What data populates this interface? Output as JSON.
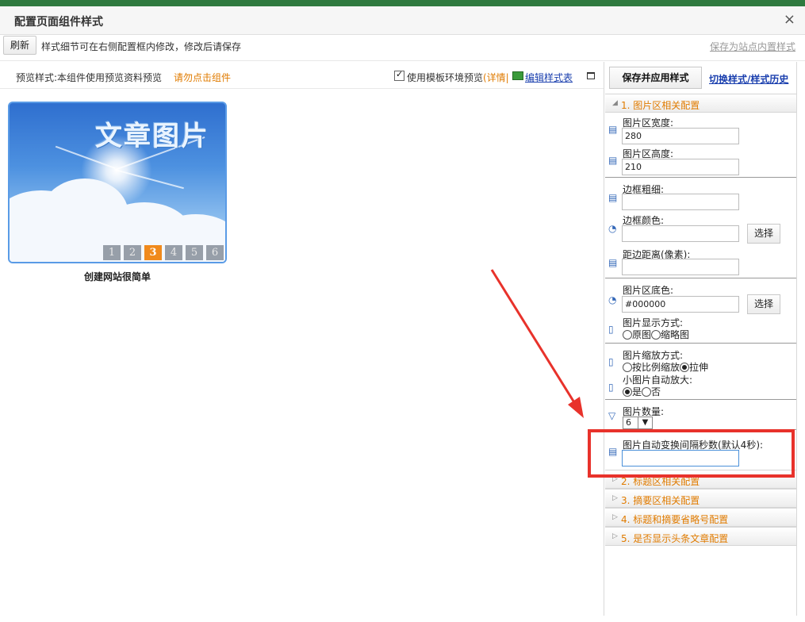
{
  "dialog": {
    "title": "配置页面组件样式",
    "close_glyph": "×"
  },
  "toolbar": {
    "refresh_label": "刷新",
    "hint": "样式细节可在右侧配置框内修改，修改后请保存",
    "save_site_style": "保存为站点内置样式"
  },
  "preview": {
    "label": "预览样式:本组件使用预览资料预览",
    "warning": "请勿点击组件",
    "use_template_label": "使用模板环境预览",
    "use_template_checked": true,
    "detail_link": "(详情|",
    "edit_style_link": "编辑样式表",
    "image_title": "文章图片",
    "pager": [
      "1",
      "2",
      "3",
      "4",
      "5",
      "6"
    ],
    "pager_active": "3",
    "caption": "创建网站很简单"
  },
  "config": {
    "save_apply": "保存并应用样式",
    "history_link": "切换样式/样式历史",
    "sections": [
      {
        "label": "1.  图片区相关配置",
        "expanded": true
      },
      {
        "label": "2.  标题区相关配置",
        "expanded": false
      },
      {
        "label": "3.  摘要区相关配置",
        "expanded": false
      },
      {
        "label": "4.  标题和摘要省略号配置",
        "expanded": false
      },
      {
        "label": "5.  是否显示头条文章配置",
        "expanded": false
      }
    ],
    "fields": {
      "width_label": "图片区宽度:",
      "width_value": "280",
      "height_label": "图片区高度:",
      "height_value": "210",
      "border_width_label": "边框粗细:",
      "border_width_value": "",
      "border_color_label": "边框颜色:",
      "border_color_value": "",
      "choose_label": "选择",
      "padding_label": "距边距离(像素):",
      "padding_value": "",
      "bg_color_label": "图片区底色:",
      "bg_color_value": "#000000",
      "display_mode_label": "图片显示方式:",
      "display_mode_options": [
        "原图",
        "缩略图"
      ],
      "scale_mode_label": "图片缩放方式:",
      "scale_mode_options": [
        "按比例缩放",
        "拉伸"
      ],
      "scale_mode_selected": "拉伸",
      "auto_enlarge_label": "小图片自动放大:",
      "auto_enlarge_options": [
        "是",
        "否"
      ],
      "auto_enlarge_selected": "是",
      "count_label": "图片数量:",
      "count_value": "6",
      "interval_label": "图片自动变换间隔秒数(默认4秒):",
      "interval_value": ""
    }
  },
  "colors": {
    "accent_orange": "#e07b00",
    "link_blue": "#1a3fae",
    "annotation_red": "#e8322b",
    "pager_active": "#f08a1c"
  }
}
